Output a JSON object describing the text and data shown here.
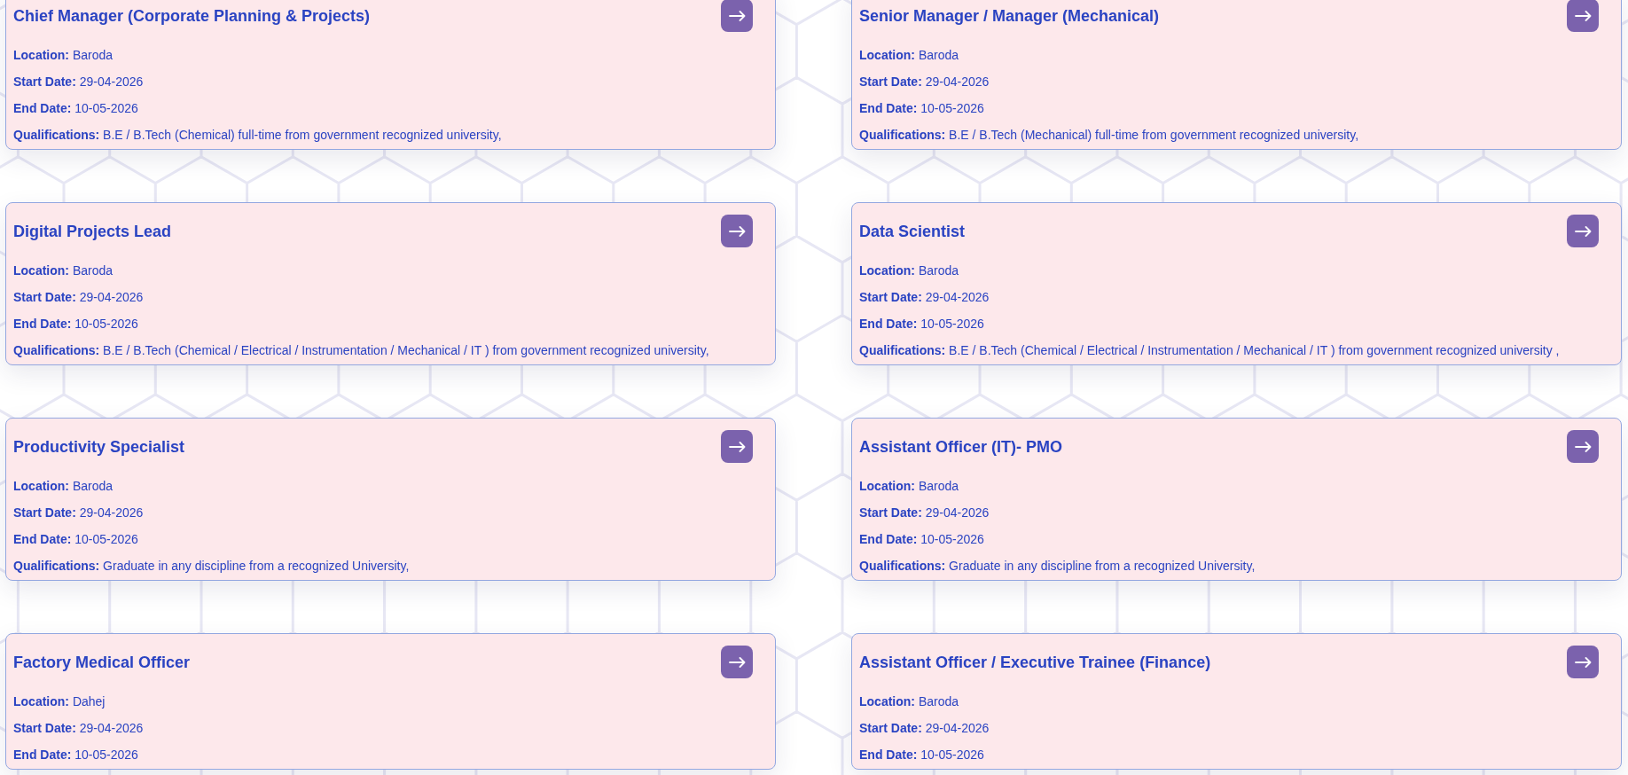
{
  "jobs": [
    {
      "title": "Chief Manager (Corporate Planning & Projects)",
      "details": [
        {
          "label": "Location:",
          "value": "Baroda"
        },
        {
          "label": "Start Date:",
          "value": "29-04-2026"
        },
        {
          "label": "End Date:",
          "value": "10-05-2026"
        },
        {
          "label": "Qualifications:",
          "value": "B.E / B.Tech (Chemical) full-time from government recognized university,"
        }
      ]
    },
    {
      "title": "Senior Manager / Manager (Mechanical)",
      "details": [
        {
          "label": "Location:",
          "value": "Baroda"
        },
        {
          "label": "Start Date:",
          "value": "29-04-2026"
        },
        {
          "label": "End Date:",
          "value": "10-05-2026"
        },
        {
          "label": "Qualifications:",
          "value": "B.E / B.Tech (Mechanical) full-time from government recognized university,"
        }
      ]
    },
    {
      "title": "Digital Projects Lead",
      "details": [
        {
          "label": "Location:",
          "value": "Baroda"
        },
        {
          "label": "Start Date:",
          "value": "29-04-2026"
        },
        {
          "label": "End Date:",
          "value": "10-05-2026"
        },
        {
          "label": "Qualifications:",
          "value": "B.E / B.Tech (Chemical / Electrical / Instrumentation / Mechanical / IT ) from government recognized university,"
        }
      ]
    },
    {
      "title": "Data Scientist",
      "details": [
        {
          "label": "Location:",
          "value": "Baroda"
        },
        {
          "label": "Start Date:",
          "value": "29-04-2026"
        },
        {
          "label": "End Date:",
          "value": "10-05-2026"
        },
        {
          "label": "Qualifications:",
          "value": "B.E / B.Tech (Chemical / Electrical / Instrumentation / Mechanical / IT ) from government recognized university ,"
        }
      ]
    },
    {
      "title": "Productivity Specialist",
      "details": [
        {
          "label": "Location:",
          "value": "Baroda"
        },
        {
          "label": "Start Date:",
          "value": "29-04-2026"
        },
        {
          "label": "End Date:",
          "value": "10-05-2026"
        },
        {
          "label": "Qualifications:",
          "value": "Graduate in any discipline from a recognized University,"
        }
      ]
    },
    {
      "title": "Assistant Officer (IT)- PMO",
      "details": [
        {
          "label": "Location:",
          "value": "Baroda"
        },
        {
          "label": "Start Date:",
          "value": "29-04-2026"
        },
        {
          "label": "End Date:",
          "value": "10-05-2026"
        },
        {
          "label": "Qualifications:",
          "value": "Graduate in any discipline from a recognized University,"
        }
      ]
    },
    {
      "title": "Factory Medical Officer",
      "details": [
        {
          "label": "Location:",
          "value": "Dahej"
        },
        {
          "label": "Start Date:",
          "value": "29-04-2026"
        },
        {
          "label": "End Date:",
          "value": "10-05-2026"
        }
      ]
    },
    {
      "title": "Assistant Officer / Executive Trainee (Finance)",
      "details": [
        {
          "label": "Location:",
          "value": "Baroda"
        },
        {
          "label": "Start Date:",
          "value": "29-04-2026"
        },
        {
          "label": "End Date:",
          "value": "10-05-2026"
        }
      ]
    }
  ]
}
